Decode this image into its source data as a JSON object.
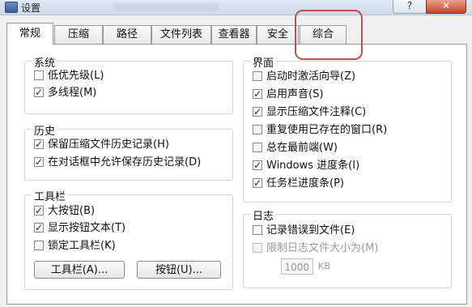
{
  "window": {
    "title": "设置",
    "help_button": "?",
    "close_button": "✕"
  },
  "tabs": [
    {
      "label": "常规"
    },
    {
      "label": "压缩"
    },
    {
      "label": "路径"
    },
    {
      "label": "文件列表"
    },
    {
      "label": "查看器"
    },
    {
      "label": "安全"
    },
    {
      "label": "综合"
    }
  ],
  "system": {
    "title": "系统",
    "items": [
      {
        "label": "低优先级(L)",
        "checked": false
      },
      {
        "label": "多线程(M)",
        "checked": true
      }
    ]
  },
  "history": {
    "title": "历史",
    "items": [
      {
        "label": "保留压缩文件历史记录(H)",
        "checked": true
      },
      {
        "label": "在对话框中允许保存历史记录(D)",
        "checked": true
      }
    ]
  },
  "toolbar": {
    "title": "工具栏",
    "items": [
      {
        "label": "大按钮(B)",
        "checked": true
      },
      {
        "label": "显示按钮文本(T)",
        "checked": true
      },
      {
        "label": "锁定工具栏(K)",
        "checked": false
      }
    ],
    "toolbar_button": "工具栏(A)...",
    "buttons_button": "按钮(U)..."
  },
  "interface": {
    "title": "界面",
    "items": [
      {
        "label": "启动时激活向导(Z)",
        "checked": false
      },
      {
        "label": "启用声音(S)",
        "checked": true
      },
      {
        "label": "显示压缩文件注释(C)",
        "checked": true
      },
      {
        "label": "重复使用已存在的窗口(R)",
        "checked": false
      },
      {
        "label": "总在最前端(W)",
        "checked": false
      },
      {
        "label": "Windows 进度条(I)",
        "checked": true
      },
      {
        "label": "任务栏进度条(P)",
        "checked": true
      }
    ]
  },
  "log": {
    "title": "日志",
    "items": [
      {
        "label": "记录错误到文件(E)",
        "checked": false
      },
      {
        "label": "限制日志文件大小为(M)",
        "checked": false
      }
    ],
    "size_value": "1000",
    "size_unit": "KB"
  }
}
